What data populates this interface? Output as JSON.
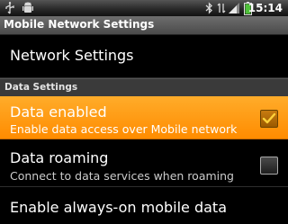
{
  "status_bar": {
    "time": "15:14",
    "icons": [
      "usb-icon",
      "android-debug-icon",
      "bluetooth-icon",
      "network-data-icon",
      "signal-icon",
      "battery-icon"
    ]
  },
  "title_bar": {
    "title": "Mobile Network Settings"
  },
  "preferences": {
    "network": {
      "title": "Network Settings"
    },
    "section_header": "Data Settings",
    "data_enabled": {
      "title": "Data enabled",
      "summary": "Enable data access over Mobile network",
      "checked": true
    },
    "data_roaming": {
      "title": "Data roaming",
      "summary": "Connect to data services when roaming",
      "checked": false
    },
    "always_on": {
      "title": "Enable always-on mobile data"
    }
  },
  "colors": {
    "highlight": "#ff9900",
    "check": "#ffd23a"
  }
}
